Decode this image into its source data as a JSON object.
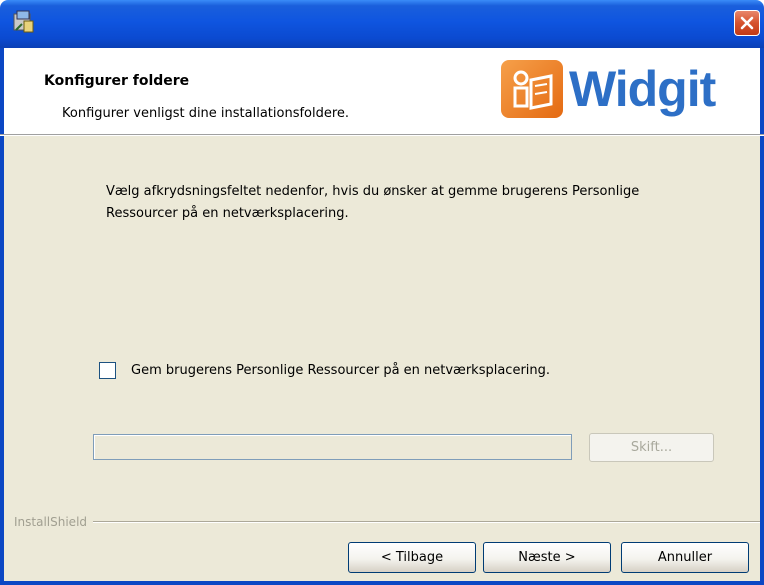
{
  "window": {
    "icon": "installer-icon",
    "close_icon": "close-icon"
  },
  "header": {
    "title": "Konfigurer foldere",
    "subtitle": "Konfigurer venligst dine installationsfoldere.",
    "logo_text": "Widgit",
    "logo_color": "#2d6fc6",
    "logo_box_color": "#e46a12"
  },
  "body": {
    "description": "Vælg afkrydsningsfeltet nedenfor, hvis du ønsker at gemme brugerens Personlige Ressourcer på en netværksplacering.",
    "checkbox_label": "Gem brugerens Personlige Ressourcer på en netværksplacering.",
    "checkbox_checked": false,
    "path_value": "",
    "change_button": "Skift..."
  },
  "footer": {
    "brand": "InstallShield",
    "back_button": "< Tilbage",
    "next_button": "Næste >",
    "cancel_button": "Annuller"
  },
  "colors": {
    "titlebar": "#0b4ad0",
    "dialog_bg": "#ece9d8",
    "close_button": "#d6532e"
  }
}
